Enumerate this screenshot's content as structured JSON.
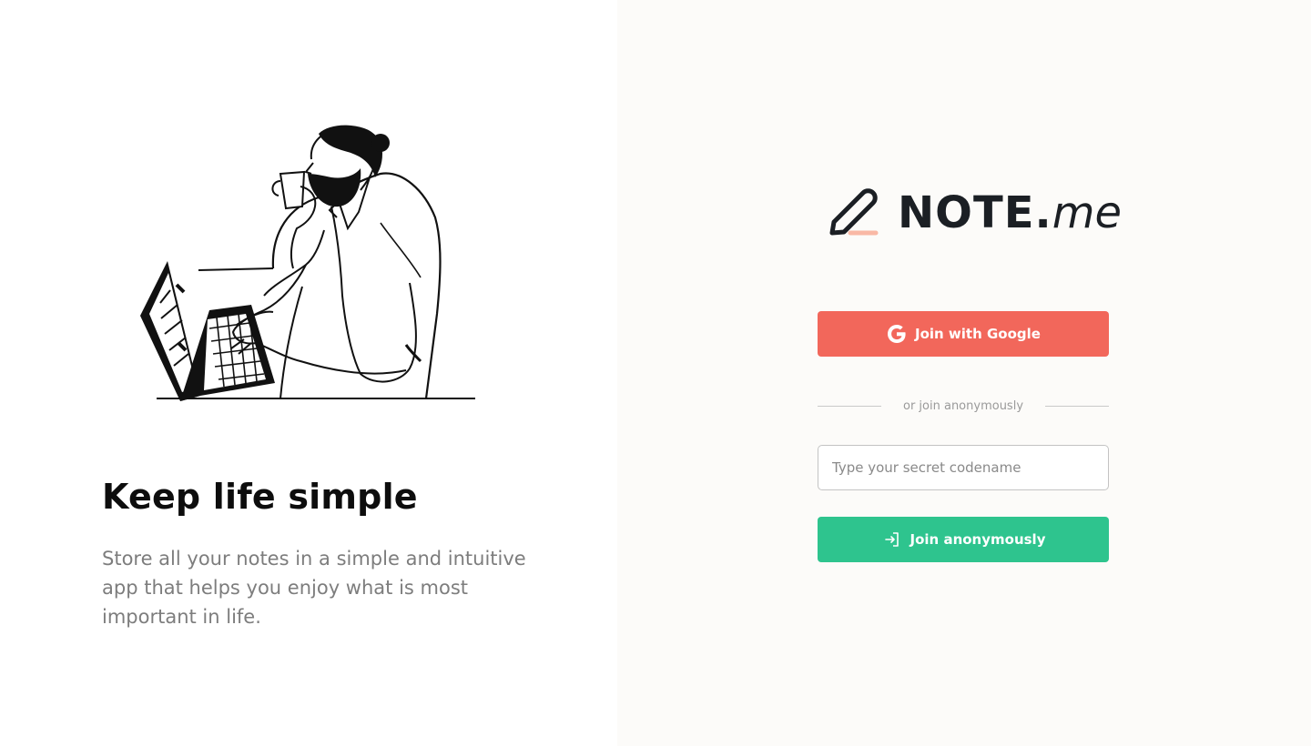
{
  "hero": {
    "headline": "Keep life simple",
    "description": "Store all your notes in a simple and intuitive app that helps you enjoy what is most important in life."
  },
  "brand": {
    "name_strong": "NOTE.",
    "name_light": "me",
    "icon": "pencil-icon"
  },
  "auth": {
    "google_button_label": "Join with Google",
    "google_icon": "google-icon",
    "divider_label": "or join anonymously",
    "codename_placeholder": "Type your secret codename",
    "codename_value": "",
    "anon_button_label": "Join anonymously",
    "anon_icon": "sign-in-icon"
  },
  "colors": {
    "google_button": "#f2675b",
    "anon_button": "#2ec48e",
    "brand_accent": "#f9b8a5",
    "right_panel_bg": "#fcfbf9"
  }
}
